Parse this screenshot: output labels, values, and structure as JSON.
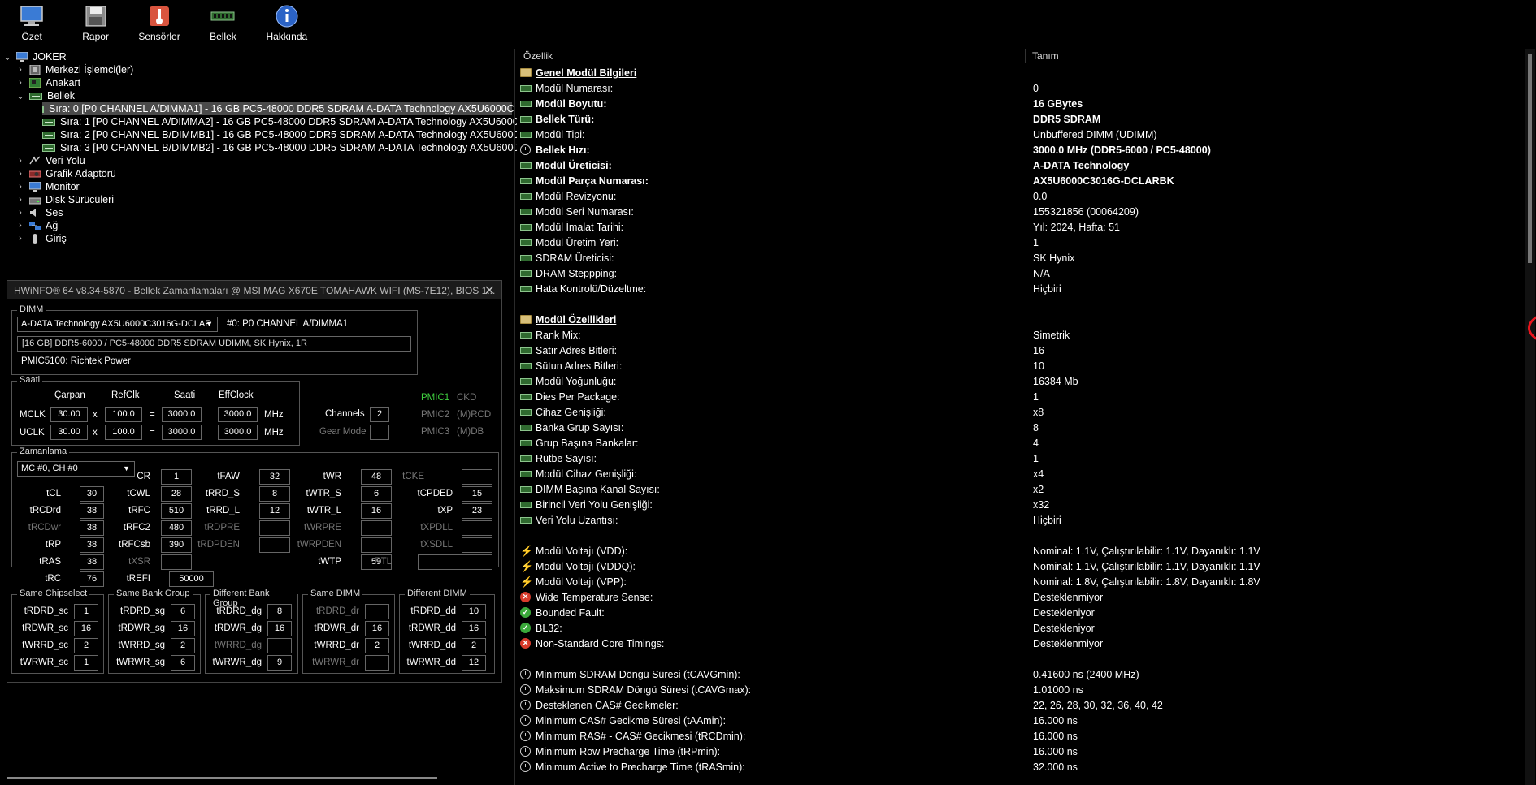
{
  "toolbar": [
    {
      "label": "Özet",
      "icon": "monitor-icon"
    },
    {
      "label": "Rapor",
      "icon": "floppy-icon"
    },
    {
      "label": "Sensörler",
      "icon": "thermometer-icon"
    },
    {
      "label": "Bellek",
      "icon": "ram-icon"
    },
    {
      "label": "Hakkında",
      "icon": "info-icon"
    }
  ],
  "tree": {
    "root": "JOKER",
    "items": [
      "Merkezi İşlemci(ler)",
      "Anakart",
      "Bellek",
      "Sıra: 0 [P0 CHANNEL A/DIMMA1] - 16 GB PC5-48000 DDR5 SDRAM A-DATA Technology AX5U6000C",
      "Sıra: 1 [P0 CHANNEL A/DIMMA2] - 16 GB PC5-48000 DDR5 SDRAM A-DATA Technology AX5U6000C",
      "Sıra: 2 [P0 CHANNEL B/DIMMB1] - 16 GB PC5-48000 DDR5 SDRAM A-DATA Technology AX5U6000C",
      "Sıra: 3 [P0 CHANNEL B/DIMMB2] - 16 GB PC5-48000 DDR5 SDRAM A-DATA Technology AX5U6000C",
      "Veri Yolu",
      "Grafik Adaptörü",
      "Monitör",
      "Disk Sürücüleri",
      "Ses",
      "Ağ",
      "Giriş"
    ]
  },
  "timing": {
    "title": "HWiNFO® 64 v8.34-5870 - Bellek Zamanlamaları @ MSI MAG X670E TOMAHAWK WIFI (MS-7E12), BIOS 1...",
    "dimm_label": "DIMM",
    "dimm_select": "A-DATA Technology AX5U6000C3016G-DCLAR",
    "dimm_slot": "#0: P0 CHANNEL A/DIMMA1",
    "dimm_desc": "[16 GB] DDR5-6000 / PC5-48000 DDR5 SDRAM UDIMM, SK Hynix, 1R",
    "pmic_text": "PMIC5100: Richtek Power",
    "saati_label": "Saati",
    "col_carpan": "Çarpan",
    "col_refclk": "RefClk",
    "col_saati": "Saati",
    "col_effclock": "EffClock",
    "mclk_label": "MCLK",
    "uclk_label": "UCLK",
    "mclk": [
      "30.00",
      "100.0",
      "3000.0",
      "3000.0"
    ],
    "uclk": [
      "30.00",
      "100.0",
      "3000.0",
      "3000.0"
    ],
    "x": "x",
    "eq": "=",
    "mhz": "MHz",
    "channels_label": "Channels",
    "channels": "2",
    "gearmode_label": "Gear Mode",
    "pmic1": "PMIC1",
    "pmic2": "PMIC2",
    "pmic3": "PMIC3",
    "ckd": "CKD",
    "mrcd": "(M)RCD",
    "mdb": "(M)DB",
    "zamanlama_label": "Zamanlama",
    "mc_select": "MC #0, CH #0",
    "t": {
      "CR": "1",
      "tFAW": "32",
      "tWR": "48",
      "tCKE": "",
      "tCL": "30",
      "tCWL": "28",
      "tRRD_S": "8",
      "tWTR_S": "6",
      "tCPDED": "15",
      "tRCDrd": "38",
      "tRFC": "510",
      "tRRD_L": "12",
      "tWTR_L": "16",
      "tXP": "23",
      "tRCDwr": "38",
      "tRFC2": "480",
      "tRDPRE": "",
      "tWRPRE": "",
      "tXPDLL": "",
      "tRP": "38",
      "tRFCsb": "390",
      "tRDPDEN": "",
      "tWRPDEN": "",
      "tXSDLL": "",
      "tRAS": "38",
      "tXSR": "",
      "tWTP": "59",
      "RTL": "",
      "tRC": "76",
      "tREFI": "50000"
    },
    "groups": [
      {
        "title": "Same Chipselect",
        "rows": [
          [
            "tRDRD_sc",
            "1"
          ],
          [
            "tRDWR_sc",
            "16"
          ],
          [
            "tWRRD_sc",
            "2"
          ],
          [
            "tWRWR_sc",
            "1"
          ]
        ]
      },
      {
        "title": "Same Bank Group",
        "rows": [
          [
            "tRDRD_sg",
            "6"
          ],
          [
            "tRDWR_sg",
            "16"
          ],
          [
            "tWRRD_sg",
            "2"
          ],
          [
            "tWRWR_sg",
            "6"
          ]
        ]
      },
      {
        "title": "Different Bank Group",
        "rows": [
          [
            "tRDRD_dg",
            "8"
          ],
          [
            "tRDWR_dg",
            "16"
          ],
          [
            "tWRRD_dg",
            ""
          ],
          [
            "tWRWR_dg",
            "9"
          ]
        ]
      },
      {
        "title": "Same DIMM",
        "rows": [
          [
            "tRDRD_dr",
            ""
          ],
          [
            "tRDWR_dr",
            "16"
          ],
          [
            "tWRRD_dr",
            "2"
          ],
          [
            "tWRWR_dr",
            ""
          ]
        ]
      },
      {
        "title": "Different DIMM",
        "rows": [
          [
            "tRDRD_dd",
            "10"
          ],
          [
            "tRDWR_dd",
            "16"
          ],
          [
            "tWRRD_dd",
            "2"
          ],
          [
            "tWRWR_dd",
            "12"
          ]
        ]
      }
    ]
  },
  "right": {
    "col_property": "Özellik",
    "col_value": "Tanım",
    "rows": [
      {
        "p": "Genel Modül Bilgileri",
        "v": "",
        "icon": "folder",
        "header": true
      },
      {
        "p": "Modül Numarası:",
        "v": "0",
        "icon": "ram"
      },
      {
        "p": "Modül Boyutu:",
        "v": "16 GBytes",
        "icon": "ram",
        "bold": true
      },
      {
        "p": "Bellek Türü:",
        "v": "DDR5 SDRAM",
        "icon": "ram",
        "bold": true
      },
      {
        "p": "Modül Tipi:",
        "v": "Unbuffered DIMM (UDIMM)",
        "icon": "ram"
      },
      {
        "p": "Bellek Hızı:",
        "v": "3000.0 MHz (DDR5-6000 / PC5-48000)",
        "icon": "clock",
        "bold": true
      },
      {
        "p": "Modül Üreticisi:",
        "v": "A-DATA Technology",
        "icon": "ram",
        "bold": true
      },
      {
        "p": "Modül Parça Numarası:",
        "v": "AX5U6000C3016G-DCLARBK",
        "icon": "ram",
        "bold": true
      },
      {
        "p": "Modül Revizyonu:",
        "v": "0.0",
        "icon": "ram"
      },
      {
        "p": "Modül Seri Numarası:",
        "v": "155321856 (00064209)",
        "icon": "ram"
      },
      {
        "p": "Modül İmalat Tarihi:",
        "v": "Yıl: 2024, Hafta: 51",
        "icon": "ram"
      },
      {
        "p": "Modül Üretim Yeri:",
        "v": "1",
        "icon": "ram"
      },
      {
        "p": "SDRAM Üreticisi:",
        "v": "SK Hynix",
        "icon": "ram"
      },
      {
        "p": "DRAM Steppping:",
        "v": "N/A",
        "icon": "ram"
      },
      {
        "p": "Hata Kontrolü/Düzeltme:",
        "v": "Hiçbiri",
        "icon": "ram"
      },
      {
        "p": "",
        "v": "",
        "icon": "none"
      },
      {
        "p": "Modül Özellikleri",
        "v": "",
        "icon": "folder",
        "header": true
      },
      {
        "p": "Rank Mix:",
        "v": "Simetrik",
        "icon": "ram"
      },
      {
        "p": "Satır Adres Bitleri:",
        "v": "16",
        "icon": "ram"
      },
      {
        "p": "Sütun Adres Bitleri:",
        "v": "10",
        "icon": "ram"
      },
      {
        "p": "Modül Yoğunluğu:",
        "v": "16384 Mb",
        "icon": "ram"
      },
      {
        "p": "Dies Per Package:",
        "v": "1",
        "icon": "ram"
      },
      {
        "p": "Cihaz Genişliği:",
        "v": "x8",
        "icon": "ram"
      },
      {
        "p": "Banka Grup Sayısı:",
        "v": "8",
        "icon": "ram"
      },
      {
        "p": "Grup Başına Bankalar:",
        "v": "4",
        "icon": "ram"
      },
      {
        "p": "Rütbe Sayısı:",
        "v": "1",
        "icon": "ram"
      },
      {
        "p": "Modül Cihaz Genişliği:",
        "v": "x4",
        "icon": "ram"
      },
      {
        "p": "DIMM Başına Kanal Sayısı:",
        "v": "x2",
        "icon": "ram"
      },
      {
        "p": "Birincil Veri Yolu Genişliği:",
        "v": "x32",
        "icon": "ram"
      },
      {
        "p": "Veri Yolu Uzantısı:",
        "v": "Hiçbiri",
        "icon": "ram"
      },
      {
        "p": "",
        "v": "",
        "icon": "none"
      },
      {
        "p": "Modül Voltajı (VDD):",
        "v": "Nominal: 1.1V, Çalıştırılabilir: 1.1V, Dayanıklı: 1.1V",
        "icon": "bolt"
      },
      {
        "p": "Modül Voltajı (VDDQ):",
        "v": "Nominal: 1.1V, Çalıştırılabilir: 1.1V, Dayanıklı: 1.1V",
        "icon": "bolt"
      },
      {
        "p": "Modül Voltajı (VPP):",
        "v": "Nominal: 1.8V, Çalıştırılabilir: 1.8V, Dayanıklı: 1.8V",
        "icon": "bolt"
      },
      {
        "p": "Wide Temperature Sense:",
        "v": "Desteklenmiyor",
        "icon": "x"
      },
      {
        "p": "Bounded Fault:",
        "v": "Destekleniyor",
        "icon": "ok"
      },
      {
        "p": "BL32:",
        "v": "Destekleniyor",
        "icon": "ok"
      },
      {
        "p": "Non-Standard Core Timings:",
        "v": "Desteklenmiyor",
        "icon": "x"
      },
      {
        "p": "",
        "v": "",
        "icon": "none"
      },
      {
        "p": "Minimum SDRAM Döngü Süresi (tCAVGmin):",
        "v": "0.41600 ns (2400 MHz)",
        "icon": "clock"
      },
      {
        "p": "Maksimum SDRAM Döngü Süresi (tCAVGmax):",
        "v": "1.01000 ns",
        "icon": "clock"
      },
      {
        "p": "Desteklenen CAS# Gecikmeler:",
        "v": "22, 26, 28, 30, 32, 36, 40, 42",
        "icon": "clock"
      },
      {
        "p": "Minimum CAS# Gecikme Süresi (tAAmin):",
        "v": "16.000 ns",
        "icon": "clock"
      },
      {
        "p": "Minimum RAS# - CAS# Gecikmesi (tRCDmin):",
        "v": "16.000 ns",
        "icon": "clock"
      },
      {
        "p": "Minimum Row Precharge Time (tRPmin):",
        "v": "16.000 ns",
        "icon": "clock"
      },
      {
        "p": "Minimum Active to Precharge Time (tRASmin):",
        "v": "32.000 ns",
        "icon": "clock"
      }
    ]
  }
}
